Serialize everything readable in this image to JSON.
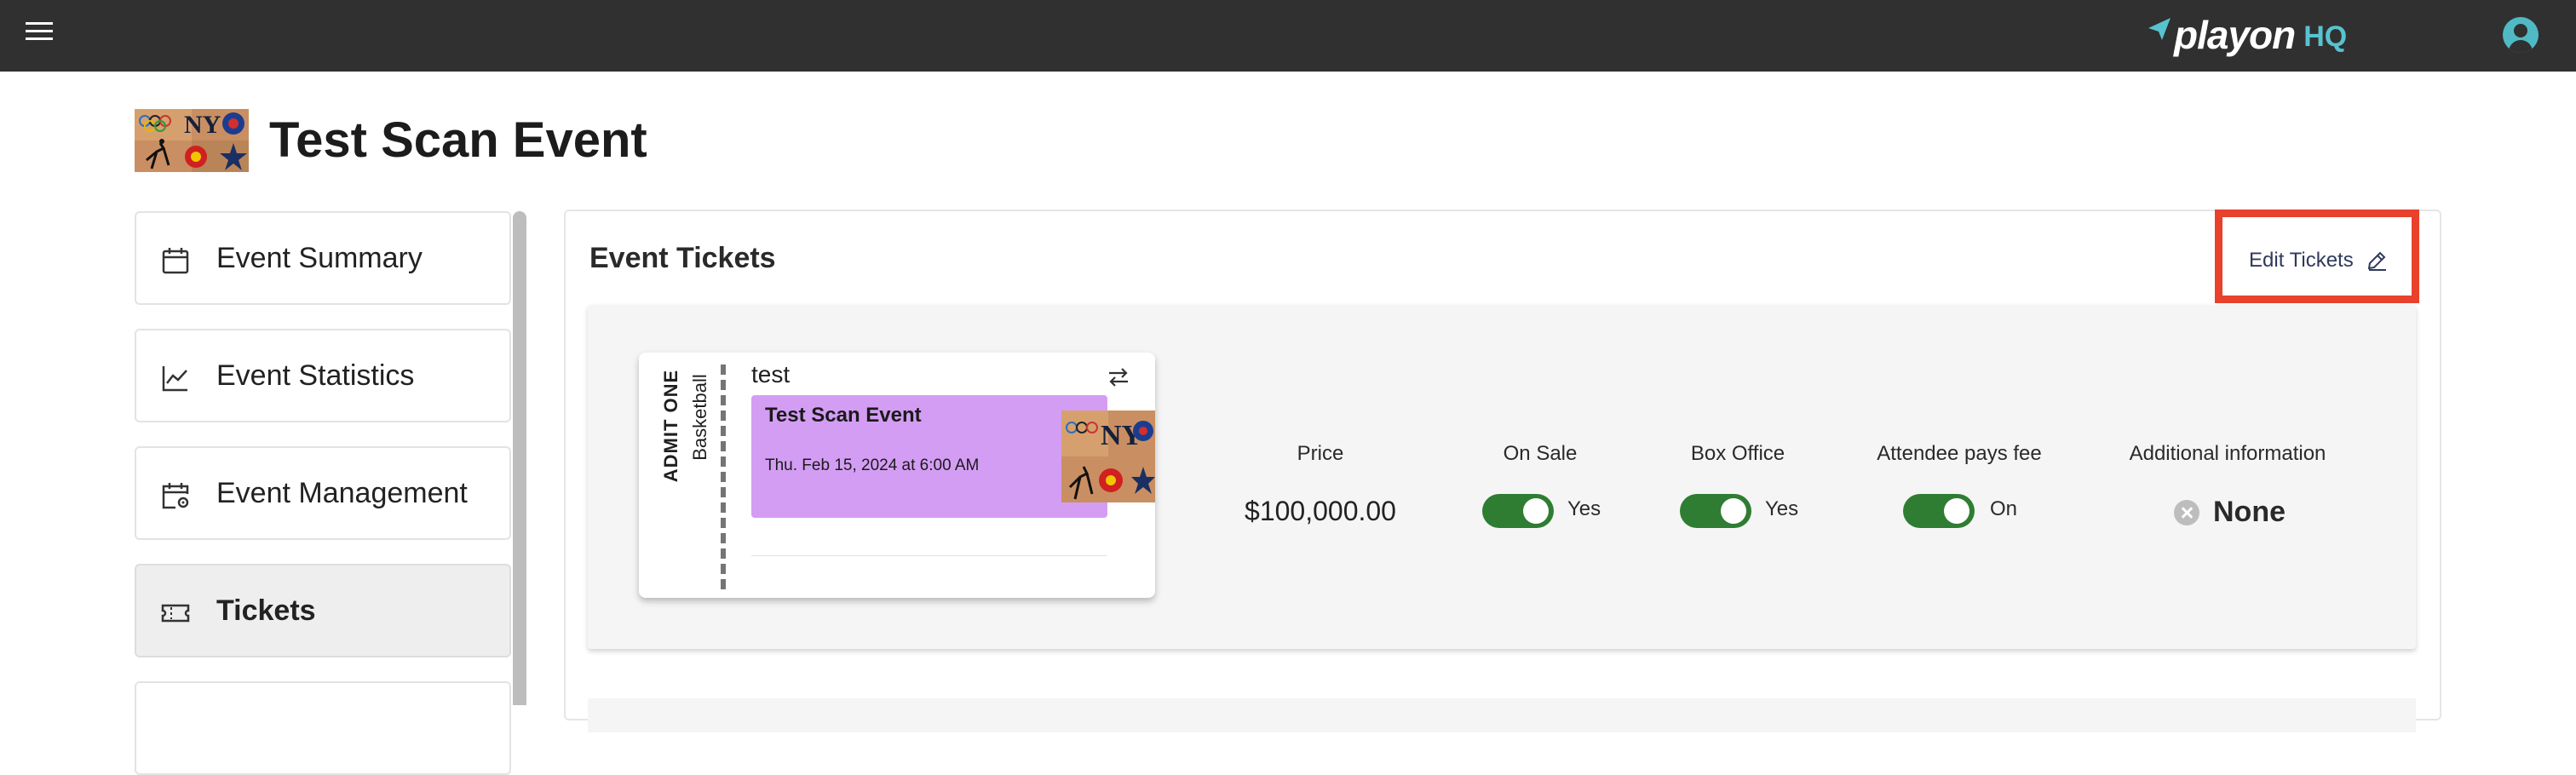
{
  "topbar": {
    "brand_word": "playon",
    "brand_suffix": "HQ",
    "accent_color": "#57c3cf",
    "menu_icon": "hamburger-menu-icon",
    "account_icon": "account-circle-icon"
  },
  "event": {
    "title": "Test Scan Event"
  },
  "sidebar": {
    "items": [
      {
        "label": "Event Summary",
        "icon": "calendar-icon"
      },
      {
        "label": "Event Statistics",
        "icon": "line-chart-icon"
      },
      {
        "label": "Event Management",
        "icon": "calendar-gear-icon"
      },
      {
        "label": "Tickets",
        "icon": "ticket-icon",
        "active": true
      }
    ]
  },
  "main": {
    "section_title": "Event Tickets",
    "edit_label": "Edit Tickets",
    "highlight_color": "#e8412c"
  },
  "ticket": {
    "name": "test",
    "admit": "ADMIT ONE",
    "sport": "Basketball",
    "card_title": "Test Scan Event",
    "card_date": "Thu. Feb 15, 2024 at 6:00 AM",
    "card_color": "#d49df4",
    "price_label": "Price",
    "price": "$100,000.00",
    "on_sale_label": "On Sale",
    "on_sale_value": "Yes",
    "box_office_label": "Box Office",
    "box_office_value": "Yes",
    "fee_label": "Attendee pays fee",
    "fee_value": "On",
    "additional_label": "Additional information",
    "additional_value": "None",
    "toggle_color": "#2e7d32"
  }
}
